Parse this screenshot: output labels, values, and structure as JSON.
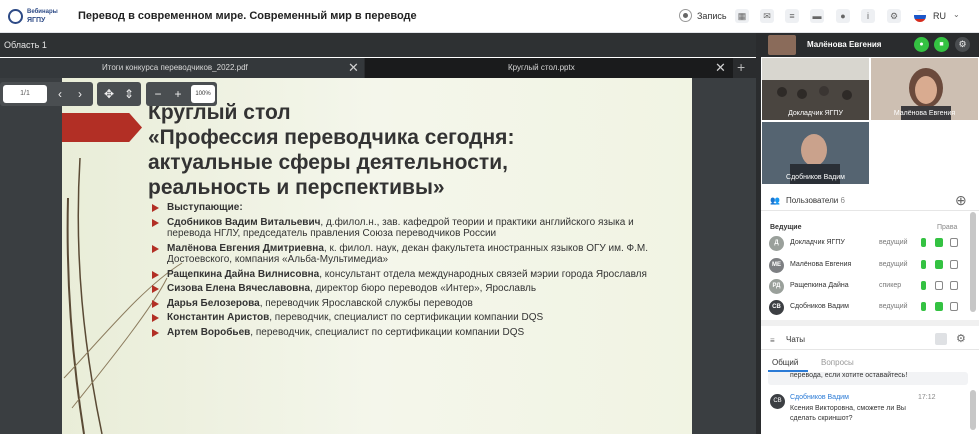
{
  "header": {
    "logo_line1": "Вебинары",
    "logo_line2": "ЯГПУ",
    "title": "Перевод в современном мире. Современный мир в переводе",
    "record_label": "Запись",
    "language": "RU"
  },
  "workspace": {
    "area_label": "Область 1",
    "tabs": [
      {
        "label": "Итоги конкурса переводчиков_2022.pdf",
        "active": false
      },
      {
        "label": "Круглый стол.pptx",
        "active": true
      }
    ],
    "page_indicator": "1/1",
    "zoom": "100%"
  },
  "slide": {
    "title": "Круглый стол\n«Профессия переводчика сегодня:\nактуальные сферы деятельности,\nреальность и перспективы»",
    "items": [
      {
        "name": "Выступающие:",
        "desc": ""
      },
      {
        "name": "Сдобников Вадим Витальевич",
        "desc": ", д.филол.н., зав. кафедрой теории и практики английского языка и перевода НГЛУ, председатель правления Союза переводчиков России"
      },
      {
        "name": "Малёнова Евгения Дмитриевна",
        "desc": ", к. филол. наук, декан факультета иностранных языков ОГУ им. Ф.М. Достоевского, компания «Альба-Мультимедиа»"
      },
      {
        "name": "Ращепкина Дайна Вилнисовна",
        "desc": ", консультант отдела международных связей мэрии города Ярославля"
      },
      {
        "name": "Сизова Елена Вячеславовна",
        "desc": ", директор бюро переводов «Интер», Ярославль"
      },
      {
        "name": "Дарья Белозерова",
        "desc": ", переводчик Ярославской службы переводов"
      },
      {
        "name": "Константин Аристов",
        "desc": ", переводчик, специалист по сертификации компании DQS"
      },
      {
        "name": "Артем Воробьев",
        "desc": ", переводчик, специалист по сертификации компании DQS"
      }
    ]
  },
  "sidebar": {
    "self_name": "Малёнова Евгения",
    "videos": [
      {
        "label": "Докладчик ЯГПУ"
      },
      {
        "label": "Малёнова Евгения"
      },
      {
        "label": "Сдобников Вадим"
      }
    ],
    "users_title": "Пользователи",
    "users_count": "6",
    "hosts_label": "Ведущие",
    "rights_label": "Права",
    "users": [
      {
        "initials": "Д",
        "name": "Докладчик ЯГПУ",
        "role": "ведущий",
        "color": "#9aa09b"
      },
      {
        "initials": "МЕ",
        "name": "Малёнова Евгения",
        "role": "ведущий",
        "color": "#7d7f82"
      },
      {
        "initials": "РД",
        "name": "Ращепкина Дайна",
        "role": "спикер",
        "color": "#9aa09b"
      },
      {
        "initials": "СВ",
        "name": "Сдобников Вадим",
        "role": "ведущий",
        "color": "#3c3f43"
      }
    ],
    "chat": {
      "title": "Чаты",
      "tabs": [
        "Общий",
        "Вопросы"
      ],
      "prev_message": "перевода, если хотите оставайтесь!",
      "message_avatar": "СВ",
      "message_author": "Сдобников Вадим",
      "message_time": "17:12",
      "message_text": "Ксения Викторовна, сможете ли Вы сделать скриншот?"
    }
  },
  "colors": {
    "accent_red": "#b22f25",
    "green": "#34c242",
    "link_blue": "#2b7bd6"
  }
}
